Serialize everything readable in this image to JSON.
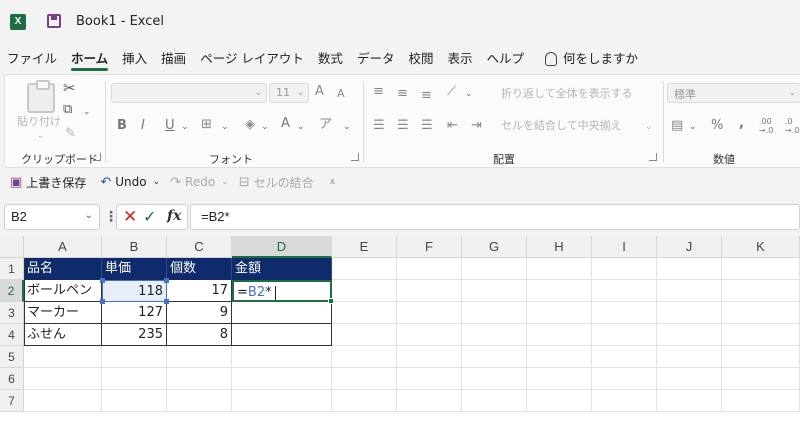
{
  "window": {
    "app_logo": "X",
    "title": "Book1  -  Excel"
  },
  "menu": {
    "tabs": [
      "ファイル",
      "ホーム",
      "挿入",
      "描画",
      "ページ レイアウト",
      "数式",
      "データ",
      "校閲",
      "表示",
      "ヘルプ"
    ],
    "active_tab": "ホーム",
    "tell_me": "何をしますか"
  },
  "ribbon": {
    "clipboard": {
      "label": "クリップボード",
      "paste_label": "貼り付け"
    },
    "font": {
      "label": "フォント",
      "font_size": "11",
      "bold": "B",
      "italic": "I",
      "underline": "U",
      "font_color": "A",
      "grow": "A",
      "shrink": "A"
    },
    "alignment": {
      "label": "配置",
      "wrap_text": "折り返して全体を表示する",
      "merge_center": "セルを結合して中央揃え"
    },
    "number": {
      "label": "数値",
      "format": "標準",
      "percent": "%",
      "comma": ",",
      "inc_decimal": ".00 →.0",
      "dec_decimal": ".0 →.00"
    }
  },
  "quick_access": {
    "save": "上書き保存",
    "undo": "Undo",
    "redo": "Redo",
    "merge": "セルの結合"
  },
  "formula_bar": {
    "name_box": "B2",
    "formula": "=B2*",
    "fx": "fx"
  },
  "sheet": {
    "columns": [
      "A",
      "B",
      "C",
      "D",
      "E",
      "F",
      "G",
      "H",
      "I",
      "J",
      "K"
    ],
    "rows": [
      "1",
      "2",
      "3",
      "4",
      "5",
      "6",
      "7"
    ],
    "active_column": "D",
    "active_row": "2",
    "headers": [
      "品名",
      "単価",
      "個数",
      "金額"
    ],
    "data": [
      {
        "name": "ボールペン",
        "price": "118",
        "qty": "17"
      },
      {
        "name": "マーカー",
        "price": "127",
        "qty": "9"
      },
      {
        "name": "ふせん",
        "price": "235",
        "qty": "8"
      }
    ],
    "edit_cell": {
      "prefix": "=",
      "ref": "B2",
      "suffix": "*"
    }
  },
  "colors": {
    "accent": "#1d6f42",
    "table_header": "#0f2b6b",
    "ref_blue": "#4472c4",
    "cancel": "#c42b1c"
  }
}
